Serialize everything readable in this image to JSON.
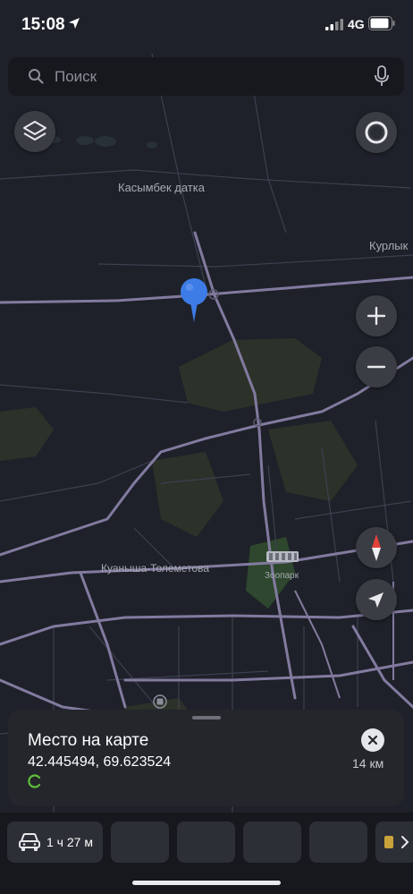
{
  "status_bar": {
    "time": "15:08",
    "network": "4G"
  },
  "search": {
    "placeholder": "Поиск"
  },
  "map": {
    "labels": {
      "kasymbek": "Касымбек датка",
      "kurlyk": "Курлык",
      "kuanysha": "Куанышa-Толеметова",
      "zoopark": "Зоопарк"
    },
    "icons": {
      "layers": "layers-icon",
      "location_ring": "location-ring-icon",
      "zoom_in": "plus-icon",
      "zoom_out": "minus-icon",
      "compass": "compass-icon",
      "my_location": "navigation-arrow-icon"
    },
    "colors": {
      "background": "#1e2129",
      "road": "#8b7fa8",
      "park": "#2e3528",
      "pin": "#3d7be6"
    }
  },
  "place_card": {
    "title": "Место на карте",
    "coordinates": "42.445494, 69.623524",
    "distance": "14 км"
  },
  "route_bar": {
    "car_time": "1 ч 27 м"
  }
}
